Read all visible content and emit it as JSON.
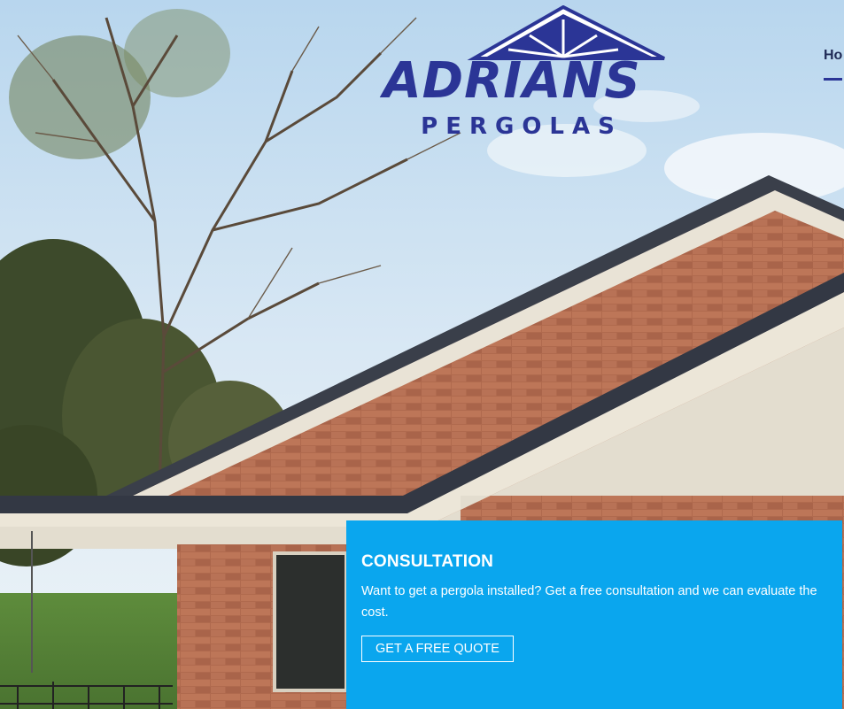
{
  "brand": {
    "name": "ADRIANS",
    "tagline": "PERGOLAS",
    "color": "#2b3596"
  },
  "nav": {
    "items": [
      {
        "label": "Ho",
        "active": true
      }
    ]
  },
  "hero": {
    "icon": "pergola-house-photo"
  },
  "consultation": {
    "title": "CONSULTATION",
    "text": "Want to get a pergola installed? Get a free consultation and we can evaluate the cost.",
    "button_label": "GET A FREE QUOTE",
    "background": "#0aa6ee"
  }
}
